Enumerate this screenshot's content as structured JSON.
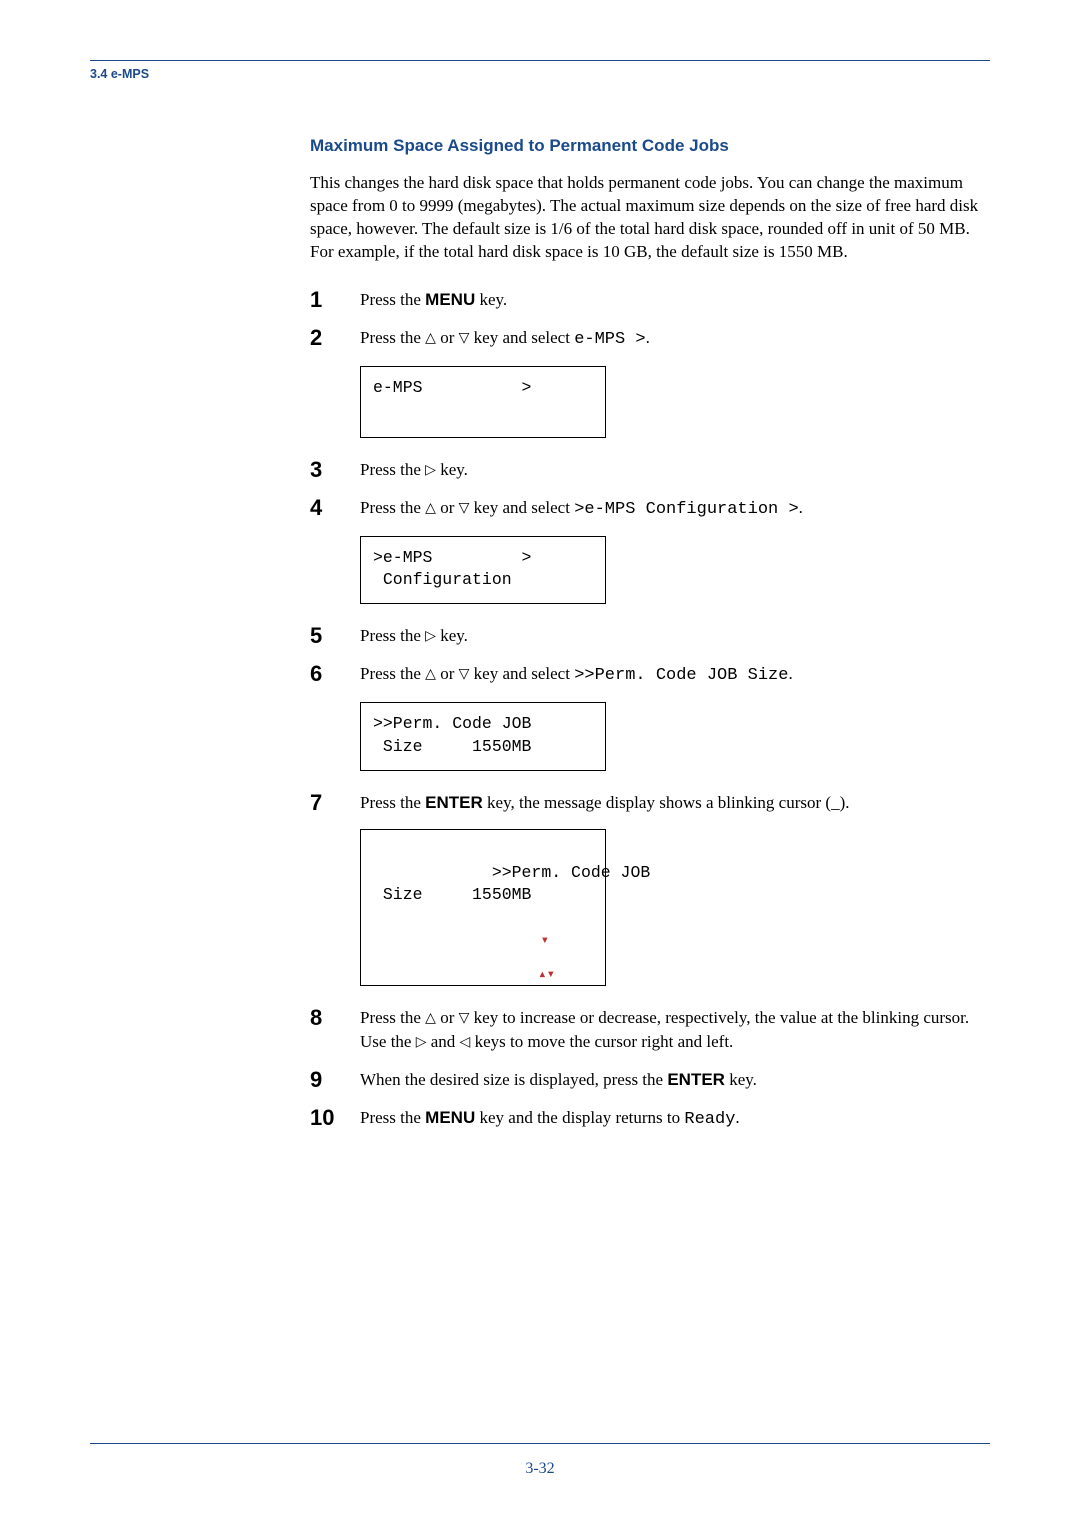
{
  "header": {
    "section": "3.4 e-MPS"
  },
  "heading": "Maximum Space Assigned to Permanent Code Jobs",
  "intro": "This changes the hard disk space that holds permanent code jobs. You can change the maximum space from 0 to 9999 (megabytes). The actual maximum size depends on the size of free hard disk space, however. The default size is 1/6 of the total hard disk space, rounded off in unit of 50 MB. For example, if the total hard disk space is 10 GB, the default size is 1550 MB.",
  "symbols": {
    "up": "△",
    "down": "▽",
    "right": "▷",
    "left": "◁"
  },
  "steps": {
    "s1": {
      "text_a": "Press the ",
      "bold": "MENU",
      "text_b": " key."
    },
    "s2": {
      "text_a": "Press the ",
      "text_b": " or ",
      "text_c": " key and select ",
      "mono": "e-MPS >",
      "text_d": ".",
      "display": "e-MPS          >"
    },
    "s3": {
      "text_a": "Press the ",
      "text_b": " key."
    },
    "s4": {
      "text_a": "Press the ",
      "text_b": " or ",
      "text_c": " key and select ",
      "mono": ">e-MPS Configuration >",
      "text_d": ".",
      "display": ">e-MPS         >\n Configuration"
    },
    "s5": {
      "text_a": "Press the ",
      "text_b": " key."
    },
    "s6": {
      "text_a": "Press the ",
      "text_b": " or ",
      "text_c": " key and select ",
      "mono": ">>Perm. Code JOB Size",
      "text_d": ".",
      "display": ">>Perm. Code JOB\n Size     1550MB"
    },
    "s7": {
      "text_a": "Press the ",
      "bold": "ENTER",
      "text_b": " key, the message display shows a blinking cursor (_).",
      "display": ">>Perm. Code JOB\n Size     1550MB"
    },
    "s8": {
      "text_a": "Press the ",
      "text_b": " or ",
      "text_c": " key to increase or decrease, respectively, the value at the blinking cursor. Use the ",
      "text_d": " and ",
      "text_e": " keys to move the cursor right and left."
    },
    "s9": {
      "text_a": "When the desired size is displayed, press the ",
      "bold": "ENTER",
      "text_b": " key."
    },
    "s10": {
      "text_a": "Press the ",
      "bold": "MENU",
      "text_b": " key and the display returns to ",
      "mono": "Ready",
      "text_c": "."
    }
  },
  "footer": {
    "page": "3-32"
  }
}
